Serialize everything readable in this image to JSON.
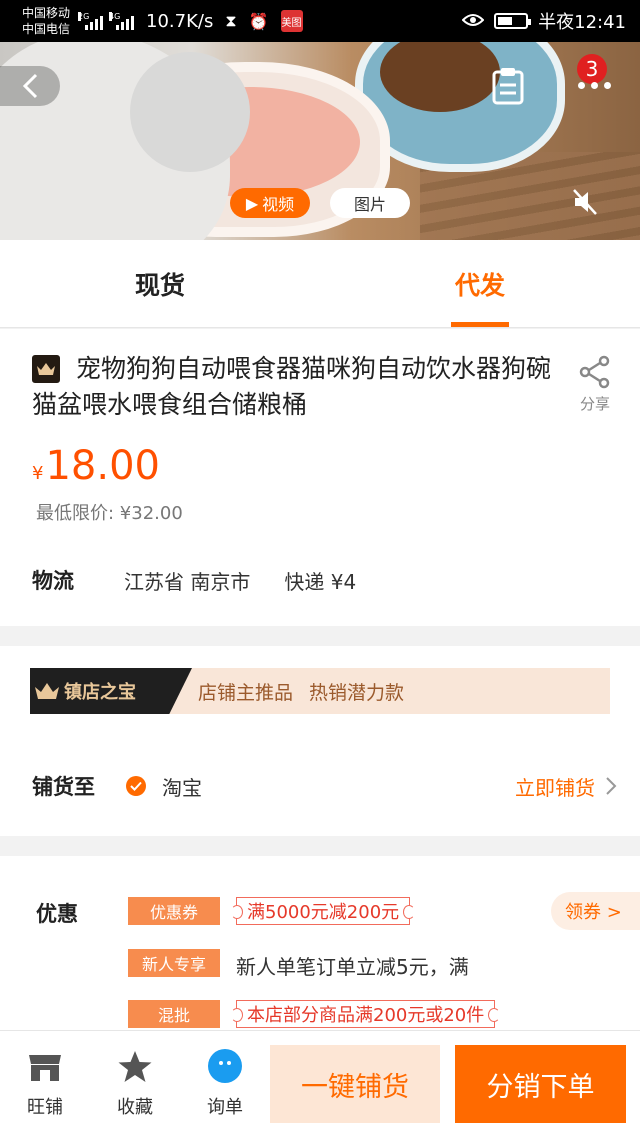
{
  "status_bar": {
    "carrier1": "中国移动",
    "carrier2": "中国电信",
    "net1": "2G",
    "net2": "4G",
    "speed": "10.7K/s",
    "app_badge": "美图",
    "time": "半夜12:41"
  },
  "hero": {
    "cart_count": "3",
    "video_label": "视频",
    "image_label": "图片"
  },
  "tabs": {
    "spot": "现货",
    "dropship": "代发",
    "active": "dropship"
  },
  "product": {
    "title": "宠物狗狗自动喂食器猫咪狗自动饮水器狗碗猫盆喂水喂食组合储粮桶",
    "share_label": "分享",
    "currency": "¥",
    "price": "18.00",
    "min_price": "最低限价: ¥32.00",
    "logistics_label": "物流",
    "location": "江苏省 南京市",
    "shipping": "快递 ¥4"
  },
  "recommend": {
    "banner_title": "镇店之宝",
    "banner_text1": "店铺主推品",
    "banner_text2": "热销潜力款",
    "distribute_label": "铺货至",
    "platform": "淘宝",
    "distribute_action": "立即铺货"
  },
  "promotions": {
    "label": "优惠",
    "items": [
      {
        "tag": "优惠券",
        "text": "满5000元减200元"
      },
      {
        "tag": "新人专享",
        "text": "新人单笔订单立减5元，满"
      },
      {
        "tag": "混批",
        "text": "本店部分商品满200元或20件"
      }
    ],
    "get_coupon": "领券 >"
  },
  "bottom_bar": {
    "shop": "旺铺",
    "favorite": "收藏",
    "inquiry": "询单",
    "one_click": "一键铺货",
    "order": "分销下单"
  },
  "colors": {
    "accent": "#ff6a00",
    "price": "#ff5000"
  }
}
